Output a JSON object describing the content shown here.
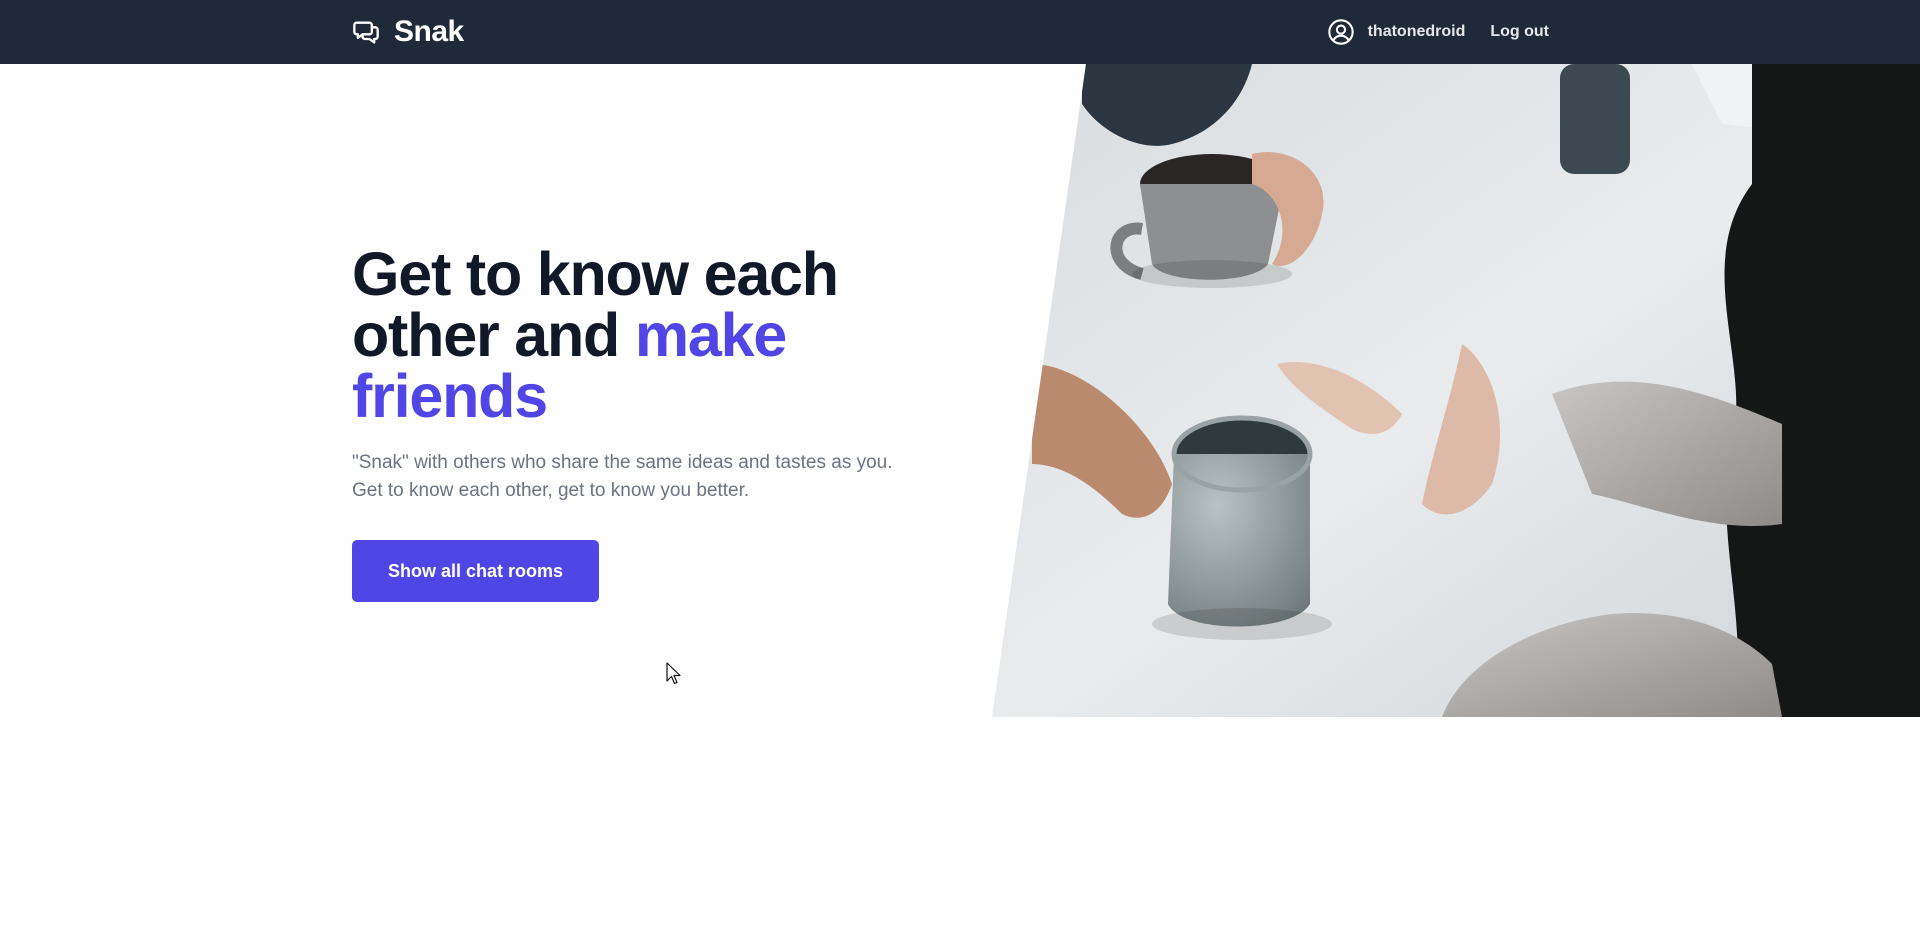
{
  "app": {
    "brand": "Snak",
    "brand_icon": "chat-bubbles-icon"
  },
  "nav": {
    "user_icon": "user-circle-icon",
    "username": "thatonedroid",
    "logout_label": "Log out"
  },
  "hero": {
    "headline_part1": "Get to know each other and ",
    "headline_accent": "make friends",
    "subtitle_line1": "\"Snak\" with others who share the same ideas and tastes as you.",
    "subtitle_line2": "Get to know each other, get to know you better.",
    "cta_label": "Show all chat rooms",
    "image": "people-with-coffee-mugs-photo"
  },
  "colors": {
    "navbar_bg": "#1f2937",
    "accent": "#4f46e5",
    "heading": "#111827",
    "body_text": "#6b7280",
    "nav_text": "#e5e7eb"
  }
}
